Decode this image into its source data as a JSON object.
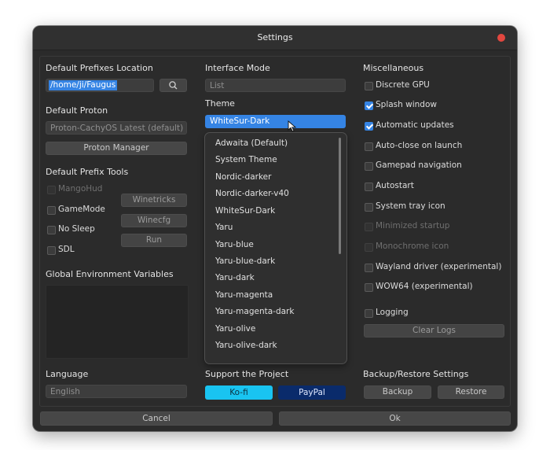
{
  "window": {
    "title": "Settings"
  },
  "left": {
    "prefix_location_label": "Default Prefixes Location",
    "prefix_location_value": "/home/ji/Faugus",
    "default_proton_label": "Default Proton",
    "default_proton_value": "Proton-CachyOS Latest (default)",
    "proton_manager_label": "Proton Manager",
    "prefix_tools_label": "Default Prefix Tools",
    "mangohud_label": "MangoHud",
    "gamemode_label": "GameMode",
    "nosleep_label": "No Sleep",
    "sdl_label": "SDL",
    "winetricks_label": "Winetricks",
    "winecfg_label": "Winecfg",
    "run_label": "Run",
    "env_vars_label": "Global Environment Variables",
    "language_label": "Language",
    "language_value": "English"
  },
  "middle": {
    "interface_mode_label": "Interface Mode",
    "interface_mode_value": "List",
    "theme_label": "Theme",
    "theme_value": "WhiteSur-Dark",
    "theme_options": [
      "Adwaita (Default)",
      "System Theme",
      "Nordic-darker",
      "Nordic-darker-v40",
      "WhiteSur-Dark",
      "Yaru",
      "Yaru-blue",
      "Yaru-blue-dark",
      "Yaru-dark",
      "Yaru-magenta",
      "Yaru-magenta-dark",
      "Yaru-olive",
      "Yaru-olive-dark"
    ],
    "support_label": "Support the Project",
    "kofi_label": "Ko-fi",
    "paypal_label": "PayPal"
  },
  "right": {
    "misc_label": "Miscellaneous",
    "options": [
      {
        "label": "Discrete GPU",
        "checked": false,
        "enabled": true
      },
      {
        "label": "Splash window",
        "checked": true,
        "enabled": true
      },
      {
        "label": "Automatic updates",
        "checked": true,
        "enabled": true
      },
      {
        "label": "Auto-close on launch",
        "checked": false,
        "enabled": true
      },
      {
        "label": "Gamepad navigation",
        "checked": false,
        "enabled": true
      },
      {
        "label": "Autostart",
        "checked": false,
        "enabled": true
      },
      {
        "label": "System tray icon",
        "checked": false,
        "enabled": true
      },
      {
        "label": "Minimized startup",
        "checked": false,
        "enabled": false
      },
      {
        "label": "Monochrome icon",
        "checked": false,
        "enabled": false
      },
      {
        "label": "Wayland driver (experimental)",
        "checked": false,
        "enabled": true
      },
      {
        "label": "WOW64 (experimental)",
        "checked": false,
        "enabled": true
      }
    ],
    "logging_label": "Logging",
    "clear_logs_label": "Clear Logs",
    "backup_restore_label": "Backup/Restore Settings",
    "backup_label": "Backup",
    "restore_label": "Restore"
  },
  "footer": {
    "cancel_label": "Cancel",
    "ok_label": "Ok"
  },
  "colors": {
    "accent": "#3584e4",
    "kofi": "#19c4f1",
    "paypal": "#0a2b6b",
    "close": "#e2473f"
  }
}
